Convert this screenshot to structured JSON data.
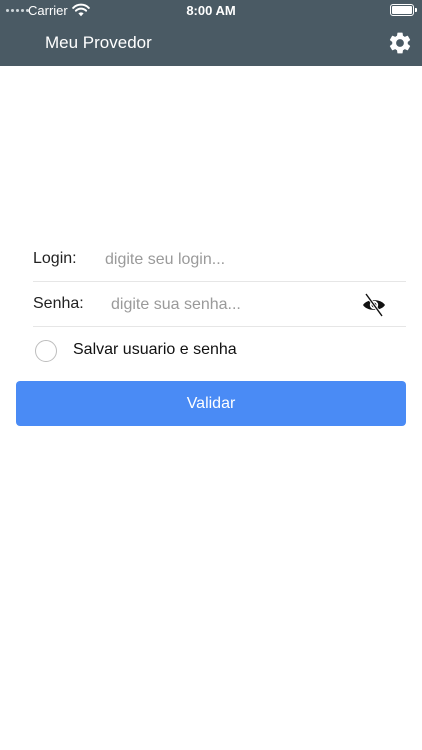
{
  "status_bar": {
    "carrier": "Carrier",
    "time": "8:00 AM",
    "battery_level": 1.0
  },
  "header": {
    "title": "Meu Provedor",
    "settings_icon": "gear-icon"
  },
  "form": {
    "login_label": "Login:",
    "login_value": "",
    "login_placeholder": "digite seu login...",
    "password_label": "Senha:",
    "password_value": "",
    "password_placeholder": "digite sua senha...",
    "password_toggle_icon": "eye-slash-icon",
    "remember_label": "Salvar usuario e senha",
    "remember_checked": false,
    "submit_label": "Validar"
  },
  "colors": {
    "header_bg": "#4a5a64",
    "button_bg": "#4a8bf5",
    "text": "#222222",
    "placeholder": "#9a9a9a"
  }
}
